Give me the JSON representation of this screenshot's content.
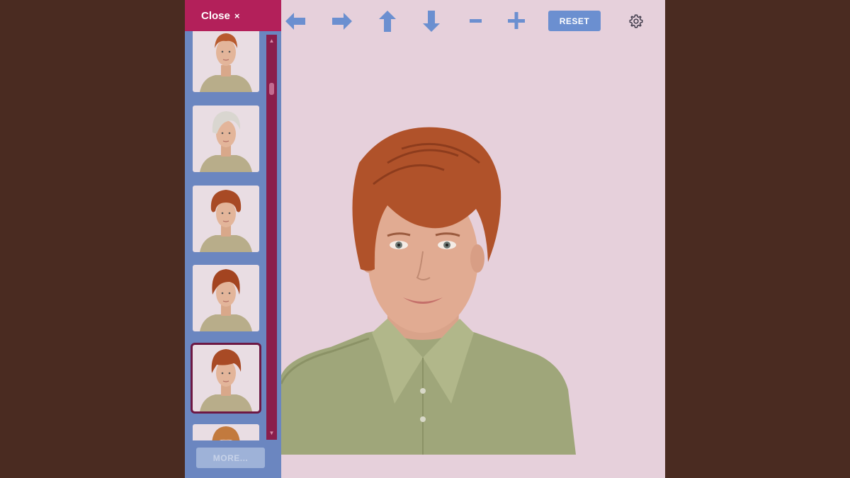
{
  "sidebar": {
    "close_label": "Close",
    "close_symbol": "×",
    "more_label": "MORE...",
    "thumbnails": [
      {
        "hair": "auburn",
        "selected": false
      },
      {
        "hair": "silver",
        "selected": false
      },
      {
        "hair": "auburn-curly",
        "selected": false
      },
      {
        "hair": "auburn-bob",
        "selected": false
      },
      {
        "hair": "auburn-pixie",
        "selected": true
      },
      {
        "hair": "blonde",
        "selected": false
      }
    ]
  },
  "toolbar": {
    "reset_label": "RESET",
    "icons": [
      "arrow-left-icon",
      "arrow-right-icon",
      "arrow-up-icon",
      "arrow-down-icon",
      "minus-icon",
      "plus-icon",
      "gear-icon"
    ]
  },
  "colors": {
    "accent_magenta": "#b3205a",
    "sidebar_blue": "#6b86c0",
    "toolbar_blue": "#6b8fd0",
    "canvas_pink": "#e6d0db",
    "page_brown": "#4a2b21"
  }
}
